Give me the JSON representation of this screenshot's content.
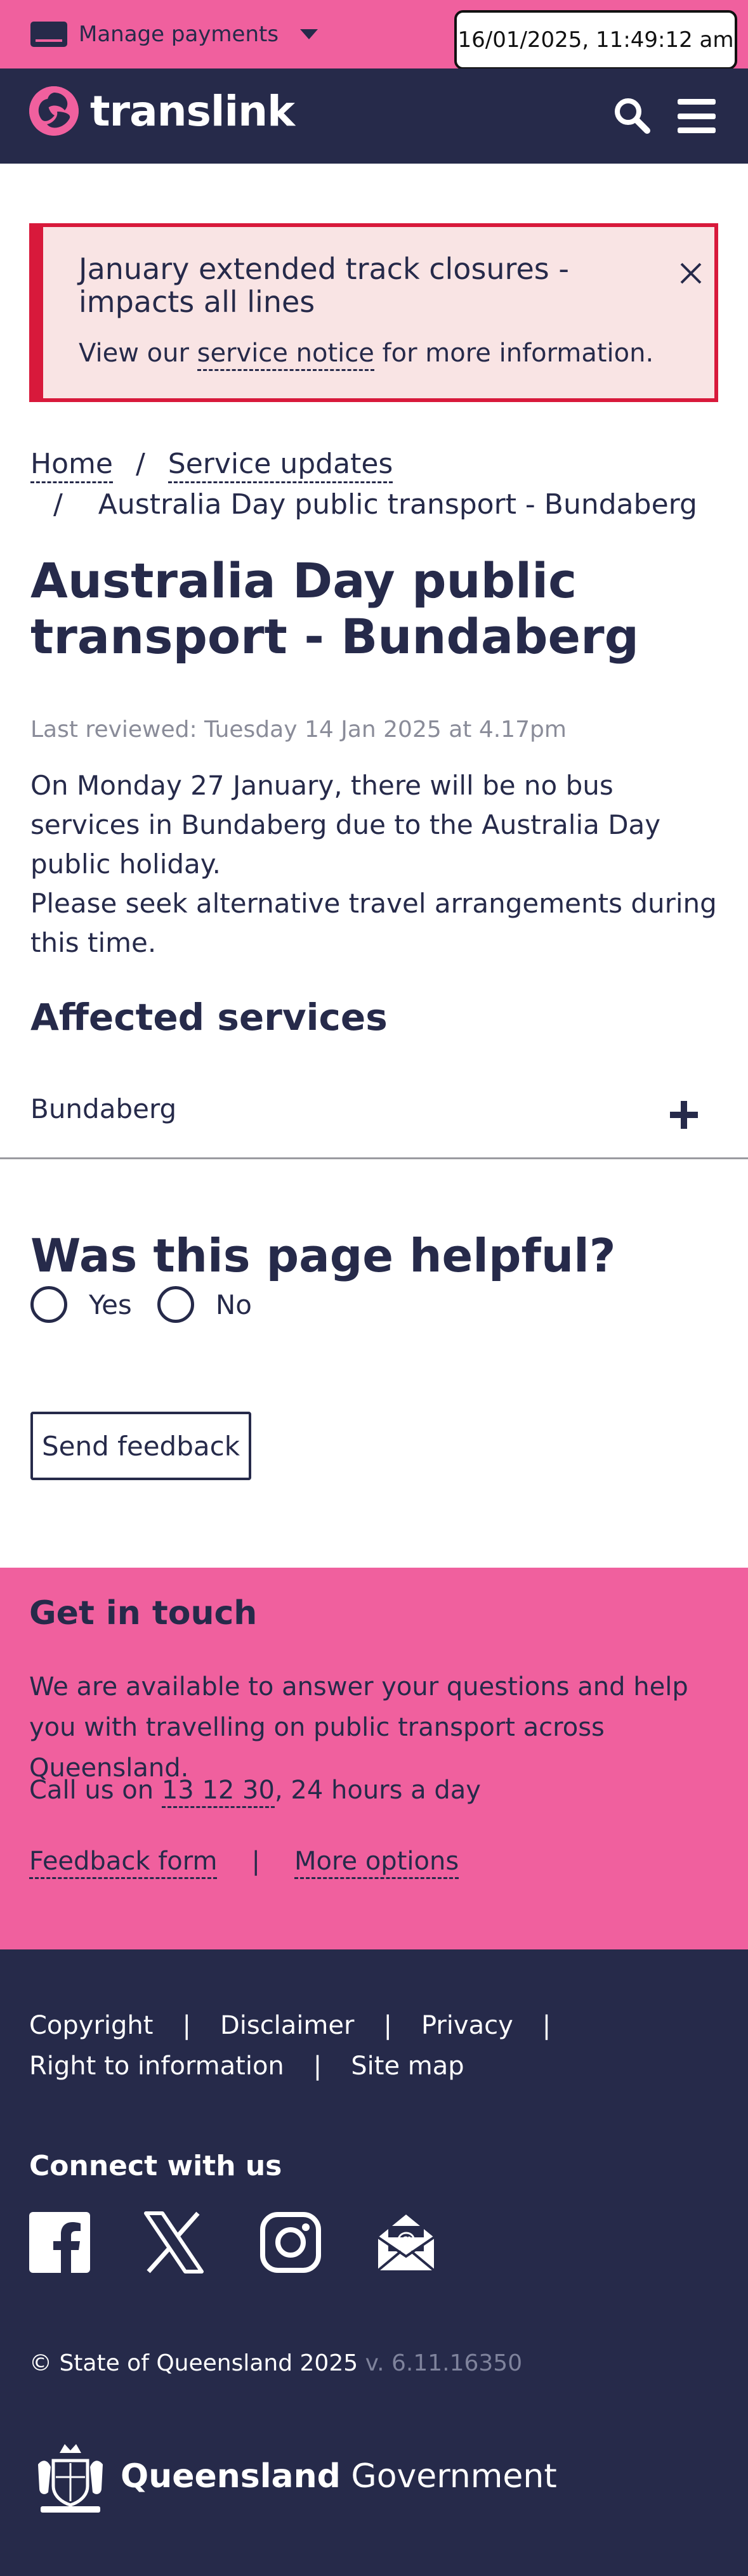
{
  "topbar": {
    "manage_label": "Manage payments",
    "timestamp": "16/01/2025, 11:49:12 am"
  },
  "header": {
    "brand": "translink"
  },
  "alert": {
    "title": "January extended track closures - impacts all lines",
    "body_prefix": "View our ",
    "body_link": "service notice",
    "body_suffix": " for more information."
  },
  "breadcrumb": {
    "home": "Home",
    "separator": "/",
    "parent": "Service updates",
    "current": "Australia Day public transport - Bundaberg"
  },
  "page": {
    "title": "Australia Day public transport - Bundaberg",
    "last_reviewed": "Last reviewed: Tuesday 14 Jan 2025 at 4.17pm",
    "para1": "On Monday 27 January, there will be no bus services in Bundaberg due to the Australia Day public holiday.",
    "para2": "Please seek alternative travel arrangements during this time.",
    "affected_heading": "Affected services",
    "affected_items": [
      "Bundaberg"
    ]
  },
  "helpful": {
    "heading": "Was this page helpful?",
    "yes": "Yes",
    "no": "No",
    "send_feedback": "Send feedback"
  },
  "contact": {
    "heading": "Get in touch",
    "text": "We are available to answer your questions and help you with travelling on public transport across Queensland.",
    "call_prefix": "Call us on ",
    "phone": "13 12 30",
    "call_suffix": ", 24 hours a day",
    "feedback_form": "Feedback form",
    "separator": "|",
    "more_options": "More options"
  },
  "footer": {
    "links": [
      "Copyright",
      "Disclaimer",
      "Privacy",
      "Right to information",
      "Site map"
    ],
    "separator": "|",
    "connect_heading": "Connect with us",
    "social": [
      "facebook-icon",
      "x-icon",
      "instagram-icon",
      "email-icon"
    ],
    "copyright": "© State of Queensland 2025",
    "version": "v. 6.11.16350",
    "gov_bold": "Queensland",
    "gov_regular": "Government"
  },
  "colors": {
    "pink": "#f0609e",
    "navy": "#262a4a",
    "alert_red": "#d8193b",
    "alert_bg": "#f9e4e4"
  }
}
